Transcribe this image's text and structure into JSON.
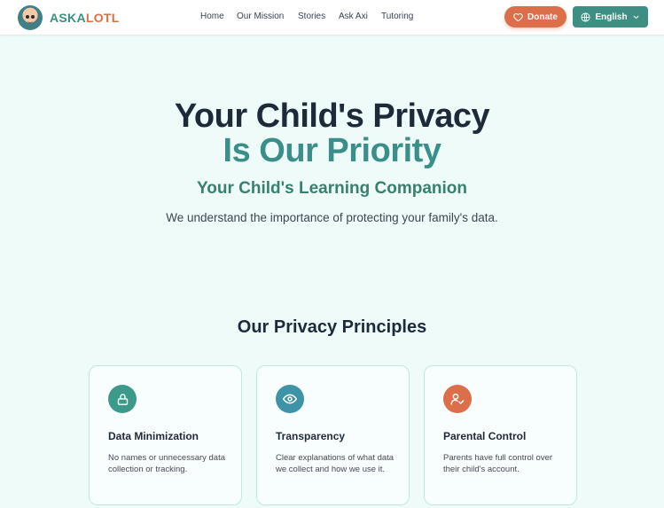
{
  "header": {
    "logo_part1": "ASKA",
    "logo_part2": "LOTL",
    "nav": [
      "Home",
      "Our Mission",
      "Stories",
      "Ask Axi",
      "Tutoring"
    ],
    "donate_label": "Donate",
    "language_label": "English"
  },
  "hero": {
    "title_line1": "Your Child's Privacy",
    "title_line2": "Is Our Priority",
    "subtitle": "Your Child's Learning Companion",
    "description": "We understand the importance of protecting your family's data."
  },
  "principles": {
    "title": "Our Privacy Principles",
    "cards": [
      {
        "title": "Data Minimization",
        "body": "No names or unnecessary data collection or tracking.",
        "icon": "lock-icon",
        "color": "#3d9a8b"
      },
      {
        "title": "Transparency",
        "body": "Clear explanations of what data we collect and how we use it.",
        "icon": "eye-icon",
        "color": "#3f93a8"
      },
      {
        "title": "Parental Control",
        "body": "Parents have full control over their child's account.",
        "icon": "user-check-icon",
        "color": "#dc6e4a"
      }
    ]
  },
  "colors": {
    "brand_teal": "#3a8f84",
    "brand_orange": "#dd6e45",
    "background": "#eefbf9"
  }
}
